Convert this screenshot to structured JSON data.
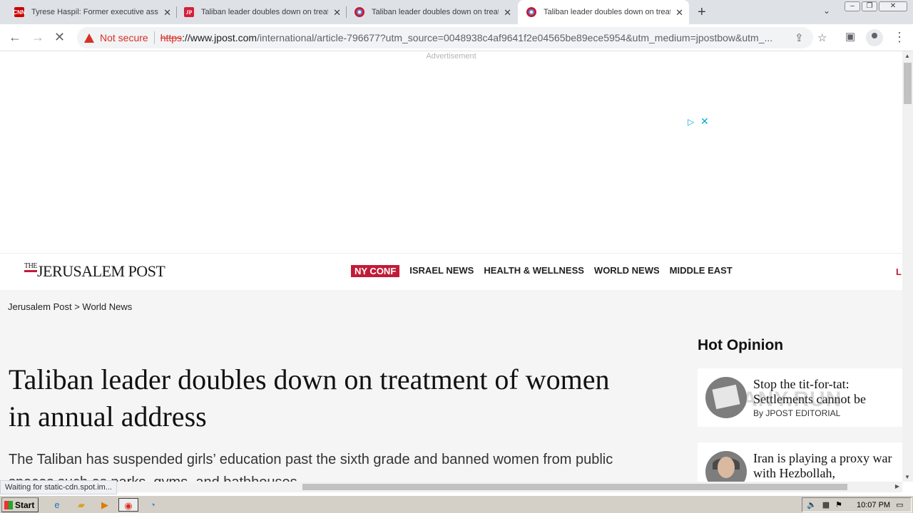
{
  "tabs": [
    {
      "title": "Tyrese Haspil: Former executive assi",
      "favicon": "cnn-favicon"
    },
    {
      "title": "Taliban leader doubles down on treat",
      "favicon": "jp-favicon"
    },
    {
      "title": "Taliban leader doubles down on treat",
      "favicon": "jpost-circle-favicon"
    },
    {
      "title": "Taliban leader doubles down on treat",
      "favicon": "jpost-circle-favicon"
    }
  ],
  "cnn_favicon_text": "CNN",
  "jp_favicon_text": "JP",
  "toolbar": {
    "security_label": "Not secure",
    "url_scheme": "https",
    "url_host": "://www.jpost.com",
    "url_path": "/international/article-796677?utm_source=0048938c4af9641f2e04565be89ece5954&utm_medium=jpostbow&utm_..."
  },
  "page": {
    "ad_label": "Advertisement",
    "logo_the": "THE",
    "logo_name": "JERUSALEM POST",
    "nav": [
      "NY CONF",
      "ISRAEL NEWS",
      "HEALTH & WELLNESS",
      "WORLD NEWS",
      "MIDDLE EAST"
    ],
    "nav_cut": "L",
    "breadcrumb": "Jerusalem Post > World News",
    "headline": "Taliban leader doubles down on treatment of women in annual address",
    "summary": "The Taliban has suspended girls’ education past the sixth grade and banned women from public spaces such as parks, gyms, and bathhouses.",
    "hot_opinion_title": "Hot Opinion",
    "opinions": [
      {
        "title": "Stop the tit-for-tat: Settlements cannot be",
        "by": "By ",
        "author": "JPOST EDITORIAL"
      },
      {
        "title": "Iran is playing a proxy war with Hezbollah,"
      }
    ],
    "watermark": "ANY.RUN"
  },
  "status_text": "Waiting for static-cdn.spot.im...",
  "taskbar": {
    "start_label": "Start",
    "clock": "10:07 PM"
  }
}
